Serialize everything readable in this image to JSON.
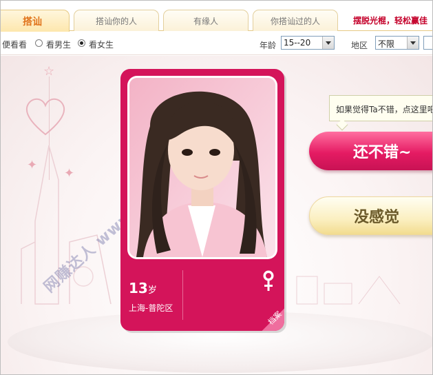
{
  "tabs": [
    {
      "label": "搭讪",
      "active": true
    },
    {
      "label": "搭讪你的人",
      "active": false
    },
    {
      "label": "有缘人",
      "active": false
    },
    {
      "label": "你搭讪过的人",
      "active": false
    }
  ],
  "promo_link": "摆脱光棍，轻松赢佳",
  "filters": {
    "browse_label": "便看看",
    "gender_options": [
      {
        "label": "看男生",
        "checked": false
      },
      {
        "label": "看女生",
        "checked": true
      }
    ],
    "age_label": "年龄",
    "age_value": "15--20",
    "region_label": "地区",
    "region_value": "不限"
  },
  "card": {
    "age_number": "13",
    "age_unit": "岁",
    "location": "上海-普陀区",
    "gender": "female",
    "profile_label": "档案"
  },
  "tooltip": "如果觉得Ta不错，点这里吧",
  "buttons": {
    "like": "还不错~",
    "nope": "没感觉"
  },
  "watermark": "网赚达人 www.wzdr.cn",
  "colors": {
    "card": "#d4145a",
    "like_button": "#e51b63",
    "nope_button": "#fbefc0",
    "active_tab_text": "#e0731a",
    "promo_text": "#c4002a"
  }
}
